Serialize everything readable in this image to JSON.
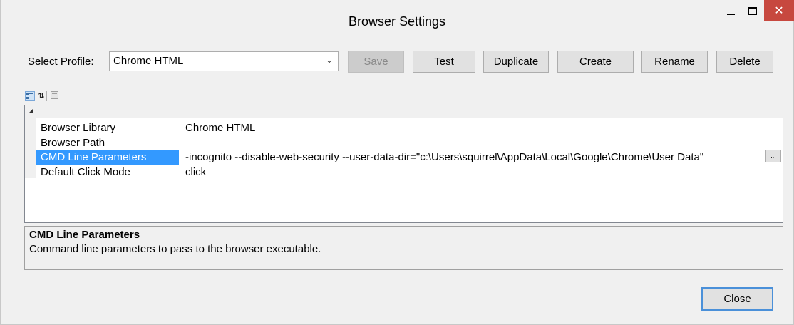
{
  "window": {
    "title": "Browser Settings",
    "controls": {
      "minimize": "minimize",
      "maximize": "maximize",
      "close": "✕"
    }
  },
  "profile": {
    "label": "Select Profile:",
    "selected": "Chrome HTML",
    "arrow": "⌄"
  },
  "toolbar": {
    "save": "Save",
    "test": "Test",
    "duplicate": "Duplicate",
    "create": "Create",
    "rename": "Rename",
    "delete": "Delete"
  },
  "grid_toolbar": {
    "categorized_icon": "categorized-icon",
    "alphabetical_icon": "alphabetical-icon",
    "alphabetical_glyph": "⇅",
    "property_pages_icon": "property-pages-icon"
  },
  "properties": [
    {
      "name": "Browser Library",
      "value": "Chrome HTML"
    },
    {
      "name": "Browser Path",
      "value": ""
    },
    {
      "name": "CMD Line Parameters",
      "value": "-incognito  --disable-web-security --user-data-dir=\"c:\\Users\\squirrel\\AppData\\Local\\Google\\Chrome\\User Data\""
    },
    {
      "name": "Default Click Mode",
      "value": "click"
    }
  ],
  "ellipsis_button": "...",
  "description": {
    "title": "CMD Line Parameters",
    "text": "Command line parameters to pass to the browser executable."
  },
  "footer": {
    "close": "Close"
  },
  "colors": {
    "selection": "#3399ff",
    "close_button": "#c7483f",
    "focus_border": "#4a90d9"
  }
}
